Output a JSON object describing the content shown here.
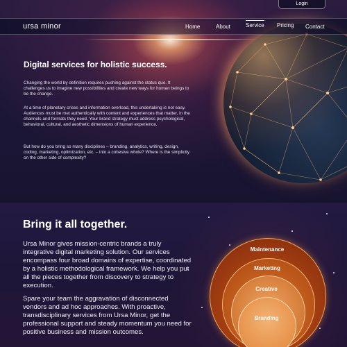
{
  "header": {
    "login_label": "Login",
    "logo_text": "ursa minor",
    "nav": [
      {
        "label": "Home"
      },
      {
        "label": "About"
      },
      {
        "label": "Service",
        "active": true
      },
      {
        "label": "Pricing"
      },
      {
        "label": "Contact"
      }
    ]
  },
  "hero": {
    "title": "Digital services for holistic success.",
    "paragraphs": [
      "Changing the world by definition requires pushing against the status quo. It challenges us to imagine new possibilities and create new ways for human beings to be the change.",
      "At a time of planetary crises and information overload, this undertaking is not easy. Audiences must be met authentically with content and experiences that matter, in the channels and formats they need. Your brand strategy must address psychological, behavioral, cultural, and aesthetic dimensions of human experience.",
      "But how do you bring so many disciplines – branding, analytics, writing, design, coding, marketing, optimization, etc. – into a cohesive whole?  Where is the simplicity on the other side of complexity?"
    ]
  },
  "section2": {
    "title": "Bring it all together.",
    "paragraphs": [
      "Ursa Minor gives mission-centric brands a truly integrative digital marketing solution. Our services encompass four broad domains of expertise, coordinated by a holistic methodological framework. We help you put all the pieces together from discovery to strategy to execution.",
      "Spare your team the aggravation of disconnected vendors and ad hoc approaches. With proactive, transdisciplinary services from Ursa Minor, get the professional support and steady momentum you need for positive business and mission outcomes."
    ],
    "circles": [
      "Maintenance",
      "Marketing",
      "Creative",
      "Branding"
    ]
  },
  "colors": {
    "accent_orange": "#e48d44",
    "background_dark": "#1d1638"
  }
}
